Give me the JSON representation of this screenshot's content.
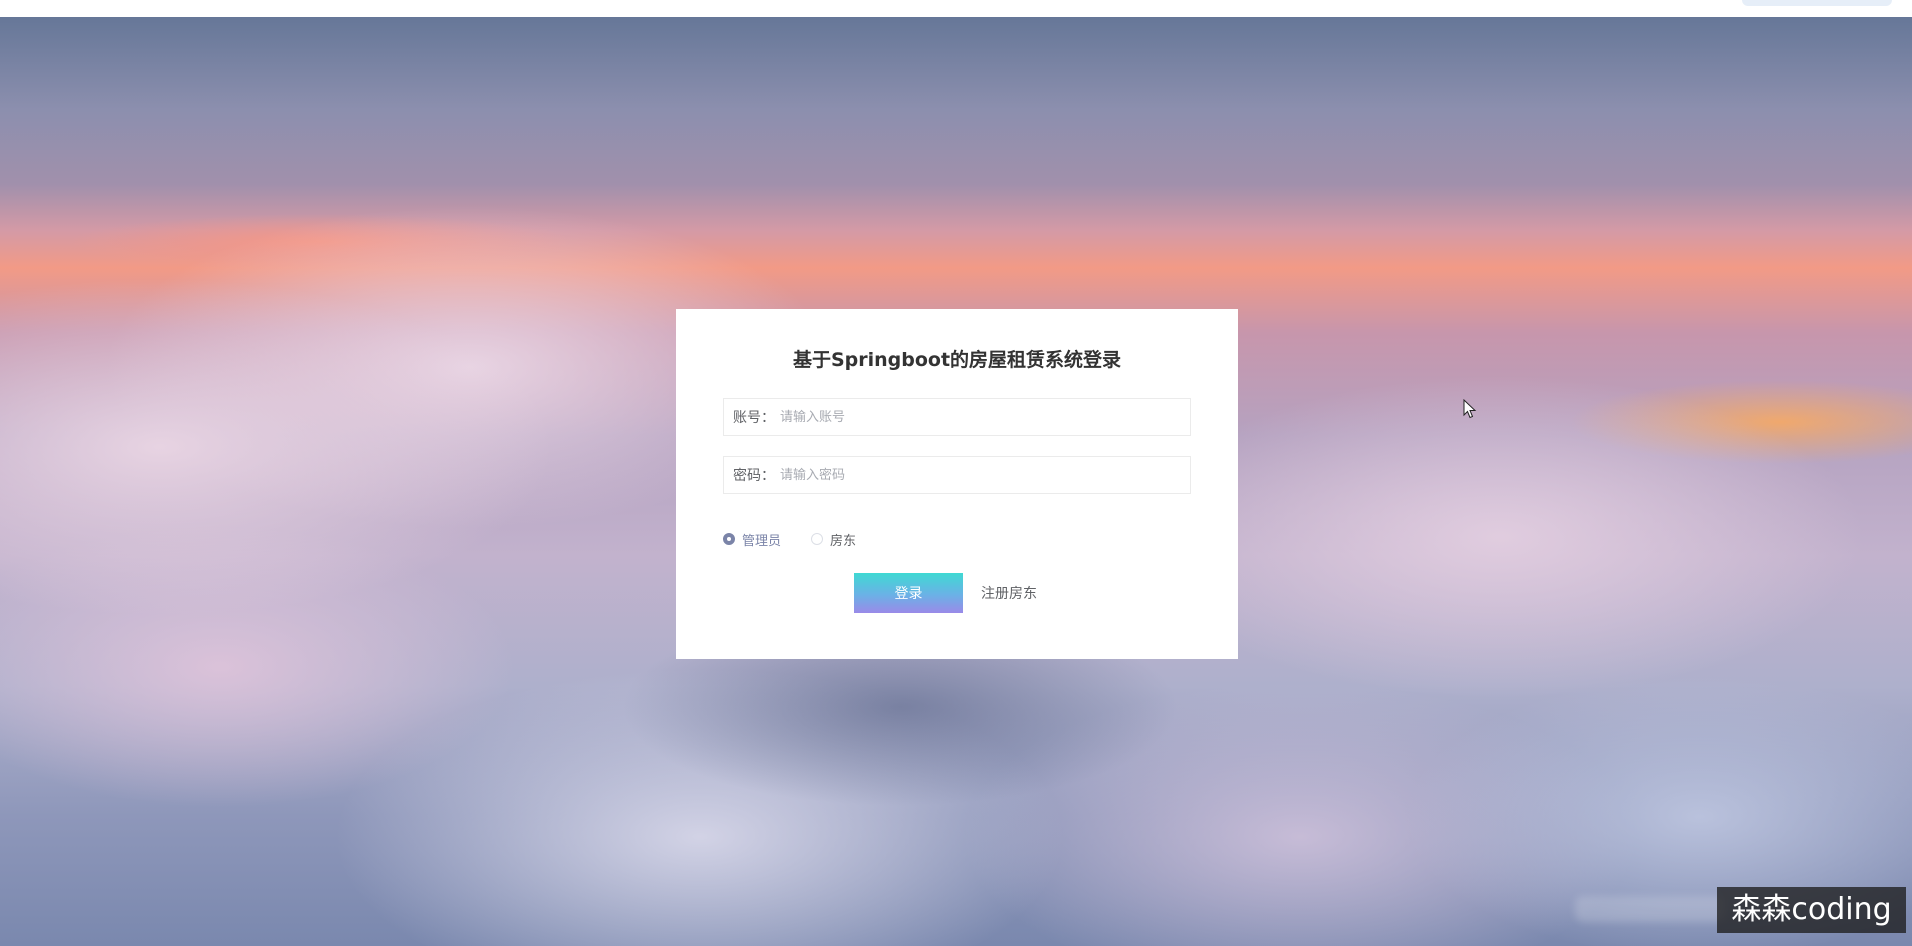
{
  "login": {
    "title": "基于Springboot的房屋租赁系统登录",
    "account": {
      "label": "账号：",
      "placeholder": "请输入账号",
      "value": ""
    },
    "password": {
      "label": "密码：",
      "placeholder": "请输入密码",
      "value": ""
    },
    "roles": [
      {
        "label": "管理员",
        "checked": true
      },
      {
        "label": "房东",
        "checked": false
      }
    ],
    "login_button": "登录",
    "register_link": "注册房东"
  },
  "watermark": "森森coding",
  "colors": {
    "accent": "#7b84a8",
    "button_gradient_start": "#3fd9d3",
    "button_gradient_end": "#9a8ae8",
    "card_background": "#ffffff"
  }
}
